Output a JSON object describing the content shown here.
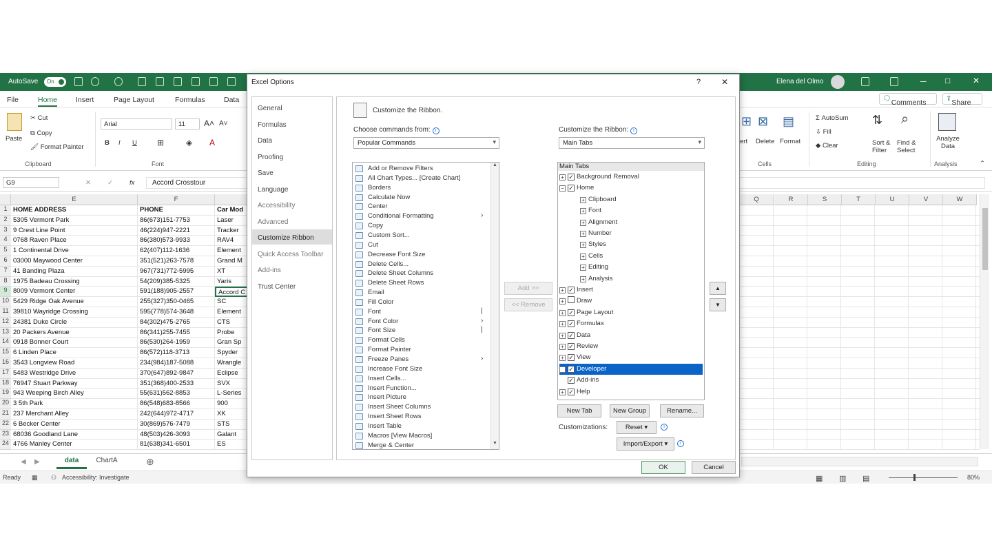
{
  "excel": {
    "autosave_label": "AutoSave",
    "autosave_state": "On",
    "user_name": "Elena del Olmo",
    "menu": [
      "File",
      "Home",
      "Insert",
      "Page Layout",
      "Formulas",
      "Data"
    ],
    "comments_label": "Comments",
    "share_label": "Share",
    "clipboard": {
      "paste": "Paste",
      "cut": "Cut",
      "copy": "Copy",
      "format_painter": "Format Painter",
      "group": "Clipboard"
    },
    "font": {
      "family": "Arial",
      "size": "11",
      "group": "Font"
    },
    "right_ribbon": {
      "insert": "ert",
      "delete": "Delete",
      "format": "Format",
      "cells_group": "Cells",
      "autosum": "AutoSum",
      "fill": "Fill",
      "clear": "Clear",
      "sort_filter": "Sort & Filter",
      "find_select": "Find & Select",
      "editing_group": "Editing",
      "analyze_data": "Analyze Data",
      "analysis_group": "Analysis"
    },
    "name_box": "G9",
    "formula_value": "Accord Crosstour",
    "fx": "fx",
    "columns_left": [
      "E",
      "F"
    ],
    "columns_right": [
      "Q",
      "R",
      "S",
      "T",
      "U",
      "V",
      "W"
    ],
    "rows": [
      {
        "n": "1",
        "addr": "HOME ADDRESS",
        "phone": "PHONE",
        "car": "Car Mod"
      },
      {
        "n": "2",
        "addr": "5305 Vermont Park",
        "phone": "86(673)151-7753",
        "car": "Laser"
      },
      {
        "n": "3",
        "addr": "9 Crest Line Point",
        "phone": "46(224)947-2221",
        "car": "Tracker"
      },
      {
        "n": "4",
        "addr": "0768 Raven Place",
        "phone": "86(380)573-9933",
        "car": "RAV4"
      },
      {
        "n": "5",
        "addr": "1 Continental Drive",
        "phone": "62(407)112-1636",
        "car": "Element"
      },
      {
        "n": "6",
        "addr": "03000 Maywood Center",
        "phone": "351(521)263-7578",
        "car": "Grand M"
      },
      {
        "n": "7",
        "addr": "41 Banding Plaza",
        "phone": "967(731)772-5995",
        "car": "XT"
      },
      {
        "n": "8",
        "addr": "1975 Badeau Crossing",
        "phone": "54(209)385-5325",
        "car": "Yaris"
      },
      {
        "n": "9",
        "addr": "8009 Vermont Center",
        "phone": "591(188)905-2557",
        "car": "Accord C"
      },
      {
        "n": "10",
        "addr": "5429 Ridge Oak Avenue",
        "phone": "255(327)350-0465",
        "car": "SC"
      },
      {
        "n": "11",
        "addr": "39810 Wayridge Crossing",
        "phone": "595(778)574-3648",
        "car": "Element"
      },
      {
        "n": "12",
        "addr": "24381 Duke Circle",
        "phone": "84(302)475-2765",
        "car": "CTS"
      },
      {
        "n": "13",
        "addr": "20 Packers Avenue",
        "phone": "86(341)255-7455",
        "car": "Probe"
      },
      {
        "n": "14",
        "addr": "0918 Bonner Court",
        "phone": "86(530)264-1959",
        "car": "Gran Sp"
      },
      {
        "n": "15",
        "addr": "6 Linden Place",
        "phone": "86(572)118-3713",
        "car": "Spyder"
      },
      {
        "n": "16",
        "addr": "3543 Longview Road",
        "phone": "234(984)187-5088",
        "car": "Wrangle"
      },
      {
        "n": "17",
        "addr": "5483 Westridge Drive",
        "phone": "370(647)892-9847",
        "car": "Eclipse"
      },
      {
        "n": "18",
        "addr": "76947 Stuart Parkway",
        "phone": "351(368)400-2533",
        "car": "SVX"
      },
      {
        "n": "19",
        "addr": "943 Weeping Birch Alley",
        "phone": "55(631)562-8853",
        "car": "L-Series"
      },
      {
        "n": "20",
        "addr": "3 5th Park",
        "phone": "86(548)683-8566",
        "car": "900"
      },
      {
        "n": "21",
        "addr": "237 Merchant Alley",
        "phone": "242(644)972-4717",
        "car": "XK"
      },
      {
        "n": "22",
        "addr": "6 Becker Center",
        "phone": "30(869)576-7479",
        "car": "STS"
      },
      {
        "n": "23",
        "addr": "68036 Goodland Lane",
        "phone": "48(503)426-3093",
        "car": "Galant"
      },
      {
        "n": "24",
        "addr": "4766 Manley Center",
        "phone": "81(638)341-6501",
        "car": "ES"
      }
    ],
    "sheet_tabs": [
      "data",
      "ChartA"
    ],
    "status_ready": "Ready",
    "status_accessibility": "Accessibility: Investigate",
    "zoom": "80%"
  },
  "dialog": {
    "title": "Excel Options",
    "help": "?",
    "close": "✕",
    "nav": [
      "General",
      "Formulas",
      "Data",
      "Proofing",
      "Save",
      "Language",
      "Accessibility",
      "Advanced",
      "Customize Ribbon",
      "Quick Access Toolbar",
      "Add-ins",
      "Trust Center"
    ],
    "nav_selected_index": 8,
    "heading": "Customize the Ribbon.",
    "choose_label": "Choose commands from:",
    "choose_value": "Popular Commands",
    "customize_label": "Customize the Ribbon:",
    "customize_value": "Main Tabs",
    "commands": [
      "Add or Remove Filters",
      "All Chart Types... [Create Chart]",
      "Borders",
      "Calculate Now",
      "Center",
      "Conditional Formatting",
      "Copy",
      "Custom Sort...",
      "Cut",
      "Decrease Font Size",
      "Delete Cells...",
      "Delete Sheet Columns",
      "Delete Sheet Rows",
      "Email",
      "Fill Color",
      "Font",
      "Font Color",
      "Font Size",
      "Format Cells",
      "Format Painter",
      "Freeze Panes",
      "Increase Font Size",
      "Insert Cells...",
      "Insert Function...",
      "Insert Picture",
      "Insert Sheet Columns",
      "Insert Sheet Rows",
      "Insert Table",
      "Macros [View Macros]",
      "Merge & Center"
    ],
    "add_button": "Add >>",
    "remove_button": "<< Remove",
    "tree_header": "Main Tabs",
    "tree": [
      {
        "label": "Background Removal",
        "level": 0,
        "pm": "+",
        "cb": true
      },
      {
        "label": "Home",
        "level": 0,
        "pm": "−",
        "cb": true
      },
      {
        "label": "Clipboard",
        "level": 1,
        "pm": "+",
        "cb": false
      },
      {
        "label": "Font",
        "level": 1,
        "pm": "+",
        "cb": false
      },
      {
        "label": "Alignment",
        "level": 1,
        "pm": "+",
        "cb": false
      },
      {
        "label": "Number",
        "level": 1,
        "pm": "+",
        "cb": false
      },
      {
        "label": "Styles",
        "level": 1,
        "pm": "+",
        "cb": false
      },
      {
        "label": "Cells",
        "level": 1,
        "pm": "+",
        "cb": false
      },
      {
        "label": "Editing",
        "level": 1,
        "pm": "+",
        "cb": false
      },
      {
        "label": "Analysis",
        "level": 1,
        "pm": "+",
        "cb": false
      },
      {
        "label": "Insert",
        "level": 0,
        "pm": "+",
        "cb": true
      },
      {
        "label": "Draw",
        "level": 0,
        "pm": "+",
        "cb": "empty"
      },
      {
        "label": "Page Layout",
        "level": 0,
        "pm": "+",
        "cb": true
      },
      {
        "label": "Formulas",
        "level": 0,
        "pm": "+",
        "cb": true
      },
      {
        "label": "Data",
        "level": 0,
        "pm": "+",
        "cb": true
      },
      {
        "label": "Review",
        "level": 0,
        "pm": "+",
        "cb": true
      },
      {
        "label": "View",
        "level": 0,
        "pm": "+",
        "cb": true
      },
      {
        "label": "Developer",
        "level": 0,
        "pm": "+",
        "cb": true,
        "selected": true
      },
      {
        "label": "Add-ins",
        "level": 0,
        "pm": "",
        "cb": true
      },
      {
        "label": "Help",
        "level": 0,
        "pm": "+",
        "cb": true
      }
    ],
    "new_tab": "New Tab",
    "new_group": "New Group",
    "rename": "Rename...",
    "customizations_label": "Customizations:",
    "reset": "Reset ▾",
    "import_export": "Import/Export ▾",
    "ok": "OK",
    "cancel": "Cancel",
    "colors": {
      "excel_green": "#217346",
      "selection_blue": "#0a64c8"
    }
  }
}
